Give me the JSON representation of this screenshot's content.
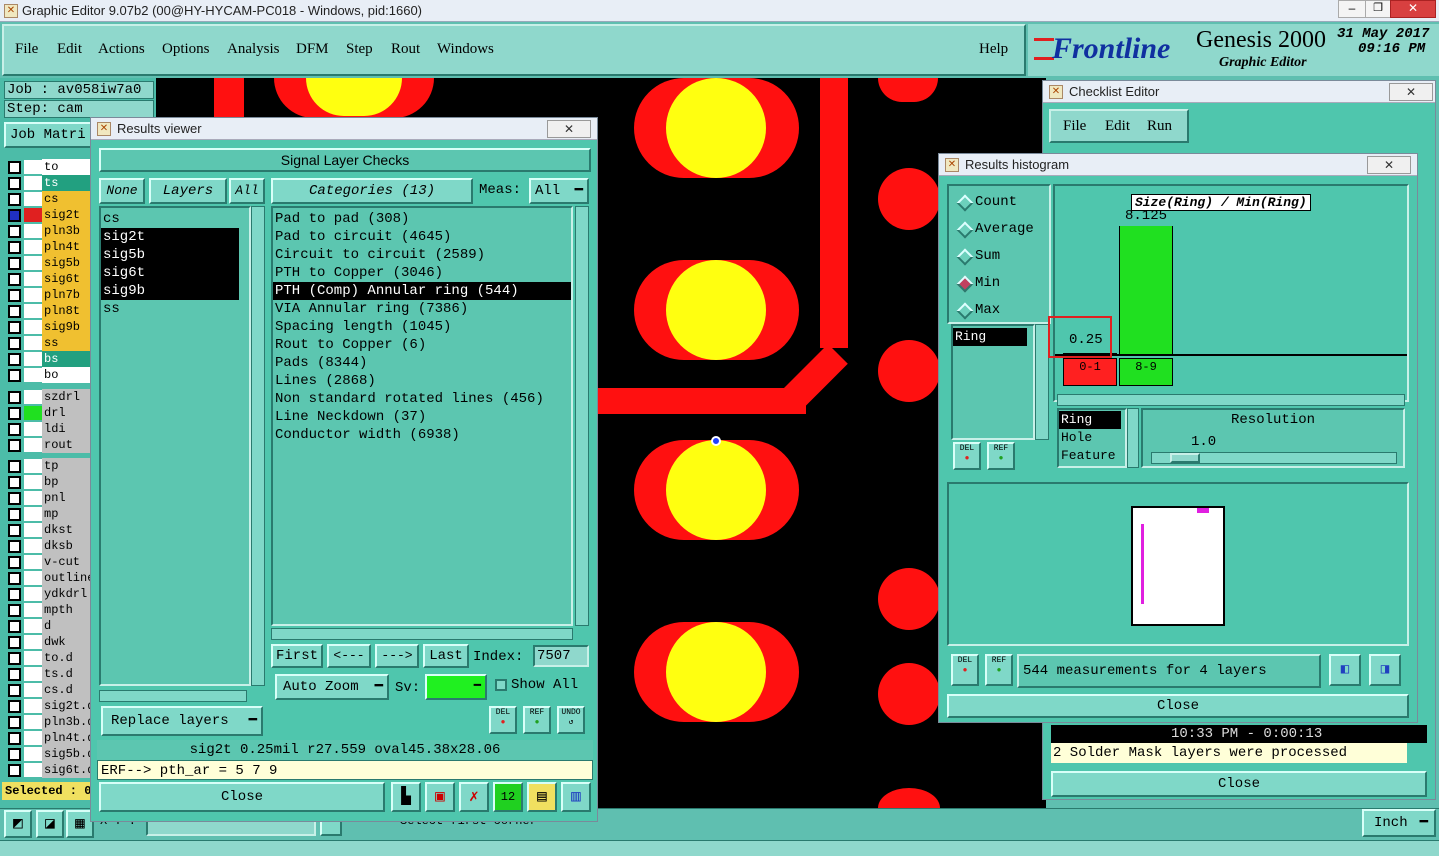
{
  "app": {
    "title": "Graphic Editor 9.07b2 (00@HY-HYCAM-PC018 - Windows, pid:1660)",
    "menu": [
      "File",
      "Edit",
      "Actions",
      "Options",
      "Analysis",
      "DFM",
      "Step",
      "Rout",
      "Windows"
    ],
    "help": "Help",
    "brand": "Frontline",
    "product": "Genesis 2000",
    "subtitle": "Graphic Editor",
    "date": "31 May 2017",
    "time": "09:16 PM"
  },
  "job": {
    "job_label": "Job : av058iw7a0",
    "step_label": "Step: cam",
    "matrix_label": "Job Matri"
  },
  "layers": [
    {
      "name": "to",
      "color": "#ffffff",
      "dot": "#ffffff"
    },
    {
      "name": "ts",
      "color": "#22a080",
      "dot": "#ffffff"
    },
    {
      "name": "cs",
      "color": "#f0c030",
      "dot": "#ffffff"
    },
    {
      "name": "sig2t",
      "color": "#f0c030",
      "dot": "#e02020"
    },
    {
      "name": "pln3b",
      "color": "#f0c030",
      "dot": "#ffffff"
    },
    {
      "name": "pln4t",
      "color": "#f0c030",
      "dot": "#ffffff"
    },
    {
      "name": "sig5b",
      "color": "#f0c030",
      "dot": "#ffffff"
    },
    {
      "name": "sig6t",
      "color": "#f0c030",
      "dot": "#ffffff"
    },
    {
      "name": "pln7b",
      "color": "#f0c030",
      "dot": "#ffffff"
    },
    {
      "name": "pln8t",
      "color": "#f0c030",
      "dot": "#ffffff"
    },
    {
      "name": "sig9b",
      "color": "#f0c030",
      "dot": "#ffffff"
    },
    {
      "name": "ss",
      "color": "#f0c030",
      "dot": "#ffffff"
    },
    {
      "name": "bs",
      "color": "#22a080",
      "dot": "#ffffff"
    },
    {
      "name": "bo",
      "color": "#ffffff",
      "dot": "#ffffff"
    },
    {
      "name": "szdrl",
      "color": "#c0c0c0",
      "dot": "#ffffff"
    },
    {
      "name": "drl",
      "color": "#c0c0c0",
      "dot": "#20e020"
    },
    {
      "name": "ldi",
      "color": "#c0c0c0",
      "dot": "#ffffff"
    },
    {
      "name": "rout",
      "color": "#c0c0c0",
      "dot": "#ffffff"
    },
    {
      "name": "tp",
      "color": "#c0c0c0",
      "dot": "#ffffff"
    },
    {
      "name": "bp",
      "color": "#c0c0c0",
      "dot": "#ffffff"
    },
    {
      "name": "pnl",
      "color": "#c0c0c0",
      "dot": "#ffffff"
    },
    {
      "name": "mp",
      "color": "#c0c0c0",
      "dot": "#ffffff"
    },
    {
      "name": "dkst",
      "color": "#c0c0c0",
      "dot": "#ffffff"
    },
    {
      "name": "dksb",
      "color": "#c0c0c0",
      "dot": "#ffffff"
    },
    {
      "name": "v-cut",
      "color": "#c0c0c0",
      "dot": "#ffffff"
    },
    {
      "name": "outline",
      "color": "#c0c0c0",
      "dot": "#ffffff"
    },
    {
      "name": "ydkdrl",
      "color": "#c0c0c0",
      "dot": "#ffffff"
    },
    {
      "name": "mpth",
      "color": "#c0c0c0",
      "dot": "#ffffff"
    },
    {
      "name": "d",
      "color": "#c0c0c0",
      "dot": "#ffffff"
    },
    {
      "name": "dwk",
      "color": "#c0c0c0",
      "dot": "#ffffff"
    },
    {
      "name": "to.d",
      "color": "#c0c0c0",
      "dot": "#ffffff"
    },
    {
      "name": "ts.d",
      "color": "#c0c0c0",
      "dot": "#ffffff"
    },
    {
      "name": "cs.d",
      "color": "#c0c0c0",
      "dot": "#ffffff"
    },
    {
      "name": "sig2t.d",
      "color": "#c0c0c0",
      "dot": "#ffffff"
    },
    {
      "name": "pln3b.d",
      "color": "#c0c0c0",
      "dot": "#ffffff"
    },
    {
      "name": "pln4t.d",
      "color": "#c0c0c0",
      "dot": "#ffffff"
    },
    {
      "name": "sig5b.d",
      "color": "#c0c0c0",
      "dot": "#ffffff"
    },
    {
      "name": "sig6t.d",
      "color": "#c0c0c0",
      "dot": "#ffffff"
    }
  ],
  "selected_label": "Selected : 0",
  "results_viewer": {
    "title": "Results viewer",
    "close_x": "✕",
    "header": "Signal Layer Checks",
    "none_btn": "None",
    "layers_btn": "Layers",
    "all_btn": "All",
    "layer_list": [
      "cs",
      "sig2t",
      "sig5b",
      "sig6t",
      "sig9b",
      "ss"
    ],
    "categories_btn": "Categories (13)",
    "meas_label": "Meas:",
    "meas_value": "All",
    "categories": [
      "Pad to pad (308)",
      "Pad to circuit (4645)",
      "Circuit to circuit (2589)",
      "PTH to Copper (3046)",
      "PTH (Comp) Annular ring (544)",
      "VIA Annular ring (7386)",
      "Spacing length (1045)",
      "Rout to Copper (6)",
      "Pads (8344)",
      "Lines (2868)",
      "Non standard rotated lines (456)",
      "Line Neckdown (37)",
      "Conductor width (6938)"
    ],
    "first_btn": "First",
    "prev_btn": "<---",
    "next_btn": "--->",
    "last_btn": "Last",
    "index_label": "Index:",
    "index_value": "7507",
    "auto_zoom": "Auto Zoom",
    "sv_label": "Sv:",
    "show_all": "Show All",
    "replace_layers": "Replace layers",
    "del": "DEL",
    "ref": "REF",
    "undo": "UNDO",
    "status": "sig2t 0.25mil  r27.559  oval45.38x28.06",
    "erf": "ERF--> pth_ar = 5 7 9",
    "close": "Close"
  },
  "checklist": {
    "title": "Checklist Editor",
    "menu": [
      "File",
      "Edit",
      "Run"
    ],
    "log_time": "10:33 PM - 0:00:13",
    "log_msg": "2 Solder Mask layers were processed",
    "close": "Close"
  },
  "histogram": {
    "title": "Results histogram",
    "modes": [
      "Count",
      "Average",
      "Sum",
      "Min",
      "Max"
    ],
    "selected_mode": "Min",
    "chart_title": "Size(Ring) / Min(Ring)",
    "measure_list": [
      "Ring"
    ],
    "chart_data": {
      "type": "bar",
      "categories": [
        "0-1",
        "8-9"
      ],
      "values": [
        0.25,
        8.125
      ],
      "value_labels": [
        "0.25",
        "8.125"
      ],
      "colors": [
        "#ff2020",
        "#20e020"
      ]
    },
    "axis_list": [
      "Ring",
      "Hole",
      "Feature"
    ],
    "resolution_label": "Resolution",
    "resolution_value": "1.0",
    "summary": "544 measurements for 4 layers",
    "del": "DEL",
    "ref": "REF",
    "close": "Close"
  },
  "bottom": {
    "unit": "Inch",
    "coord_prefix": "X Y :",
    "prompt": "Select first corner"
  }
}
